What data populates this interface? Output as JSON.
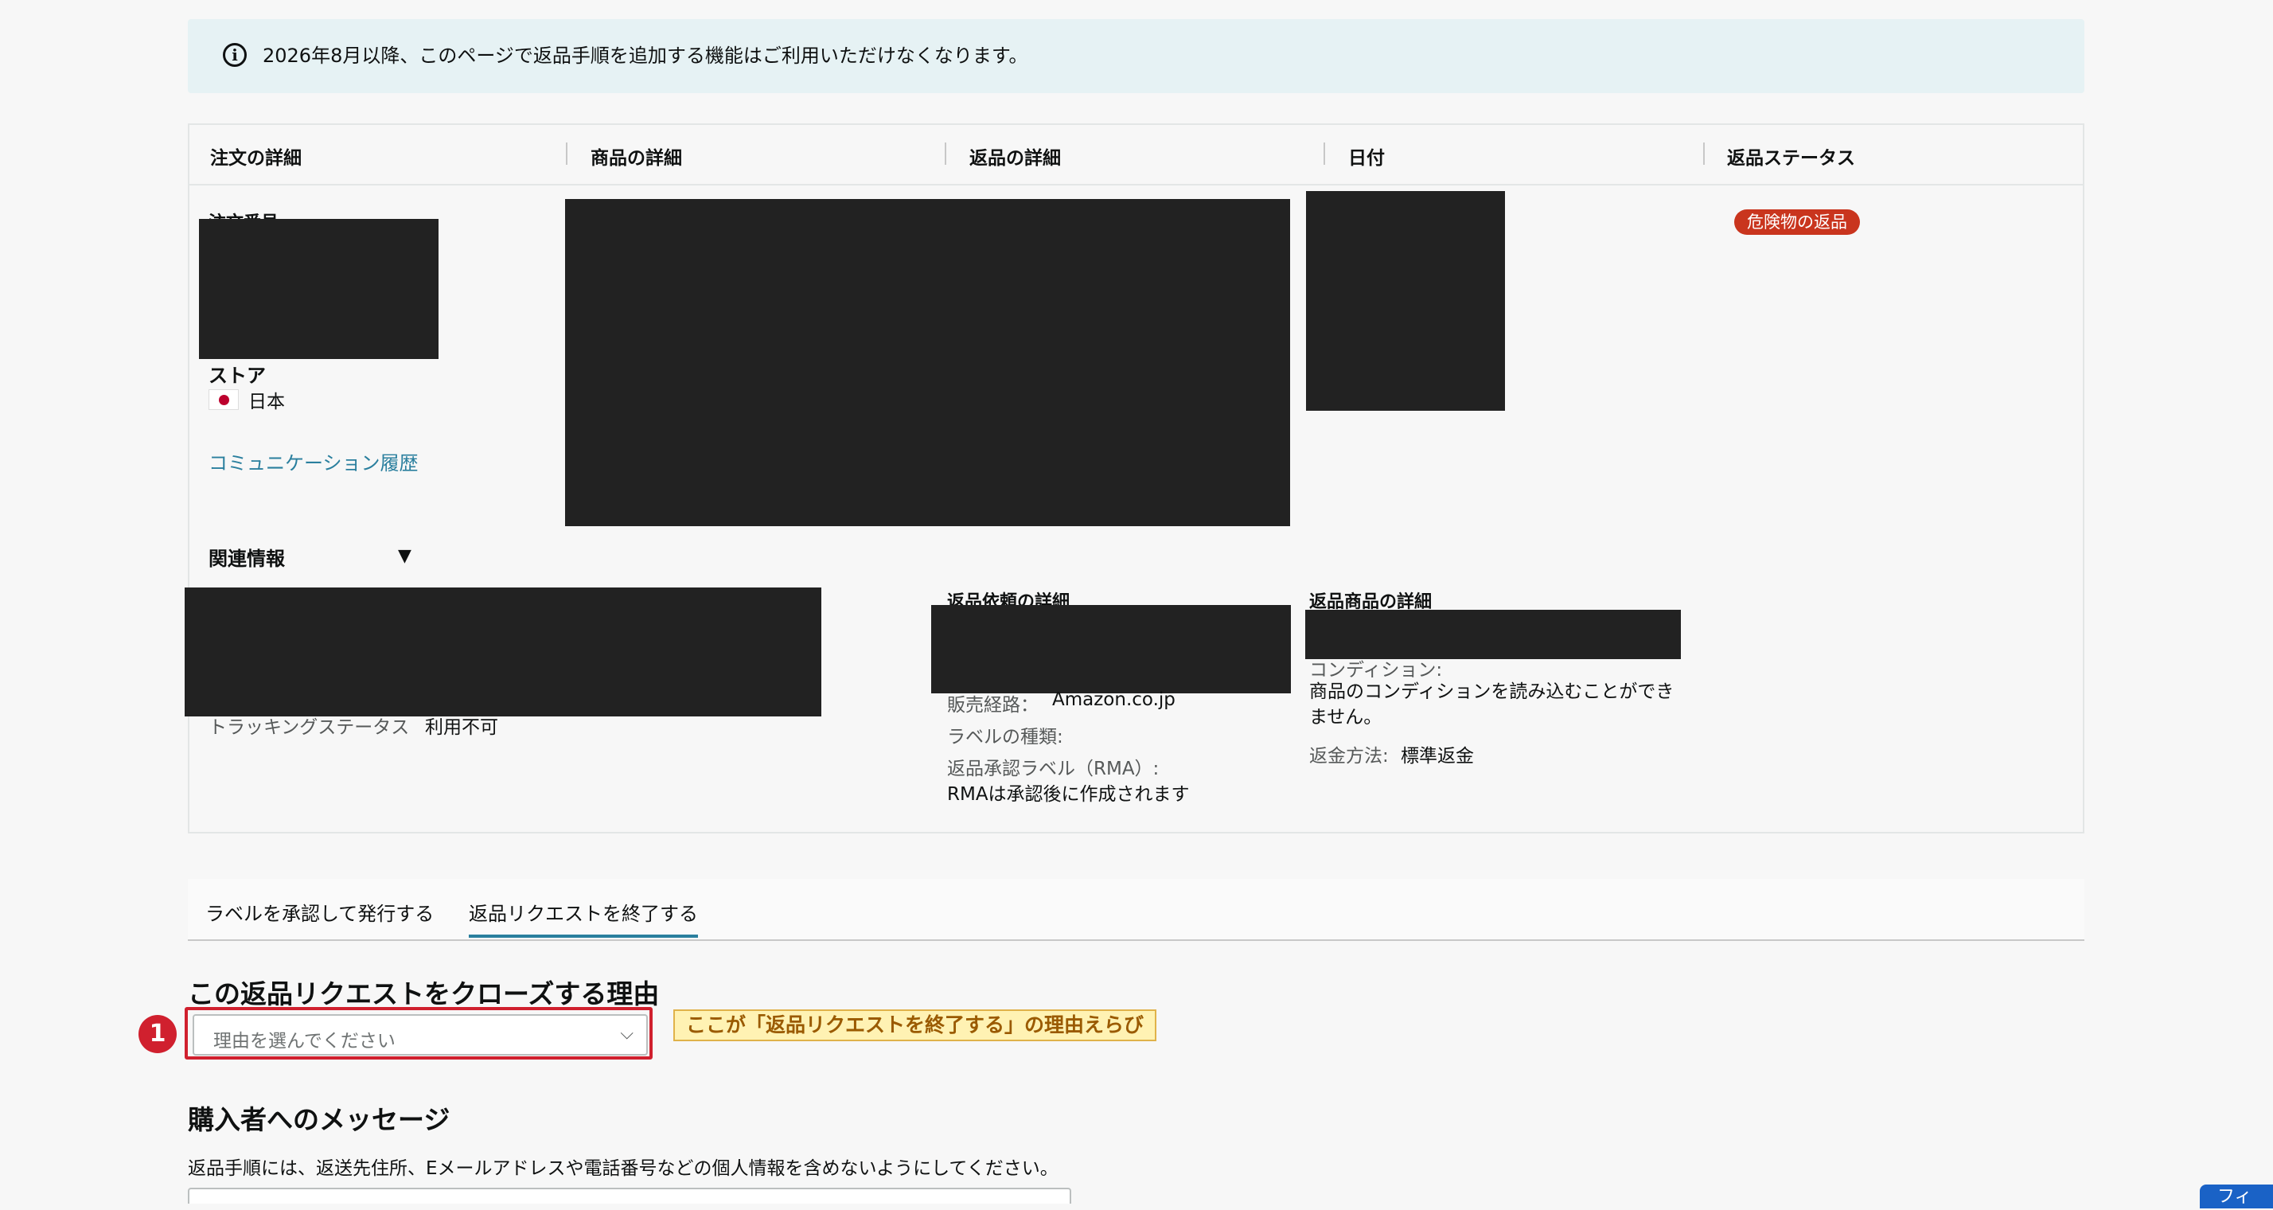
{
  "banner": {
    "icon": "info-icon",
    "text": "2026年8月以降、このページで返品手順を追加する機能はご利用いただけなくなります。"
  },
  "table": {
    "headers": [
      "注文の詳細",
      "商品の詳細",
      "返品の詳細",
      "日付",
      "返品ステータス"
    ],
    "order": {
      "order_number_label": "注文番号:",
      "store_label": "ストア",
      "store_value": "日本",
      "communication_link": "コミュニケーション履歴"
    },
    "status_badge": "危険物の返品",
    "related": {
      "toggle_label": "関連情報",
      "toggle_icon": "triangle-down-icon",
      "tracking_status_label": "トラッキングステータス",
      "tracking_status_value": "利用不可"
    },
    "return_request": {
      "title": "返品依頼の詳細",
      "sales_channel_label": "販売経路：",
      "sales_channel_value": "Amazon.co.jp",
      "label_type_label": "ラベルの種類:",
      "rma_label": "返品承認ラベル（RMA）:",
      "rma_value": "RMAは承認後に作成されます"
    },
    "return_item": {
      "title": "返品商品の詳細",
      "condition_label": "コンディション:",
      "condition_value": "商品のコンディションを読み込むことができません。",
      "refund_method_label": "返金方法:",
      "refund_method_value": "標準返金"
    }
  },
  "tabs": [
    {
      "label": "ラベルを承認して発行する",
      "active": false
    },
    {
      "label": "返品リクエストを終了する",
      "active": true
    }
  ],
  "close_reason": {
    "title": "この返品リクエストをクローズする理由",
    "placeholder": "理由を選んでください",
    "chevron_icon": "chevron-down-icon",
    "annotation_number": "1",
    "annotation_note": "ここが「返品リクエストを終了する」の理由えらび"
  },
  "buyer_message": {
    "title": "購入者へのメッセージ",
    "hint": "返品手順には、返送先住所、Eメールアドレスや電話番号などの個人情報を含めないようにしてください。"
  },
  "corner_button": "フィ",
  "colors": {
    "banner_bg": "#e6f2f4",
    "link": "#2a7f9e",
    "badge": "#c9351e",
    "highlight_red": "#d0202e",
    "note_bg": "#fff2b3",
    "tab_active_underline": "#2a7f9e"
  }
}
